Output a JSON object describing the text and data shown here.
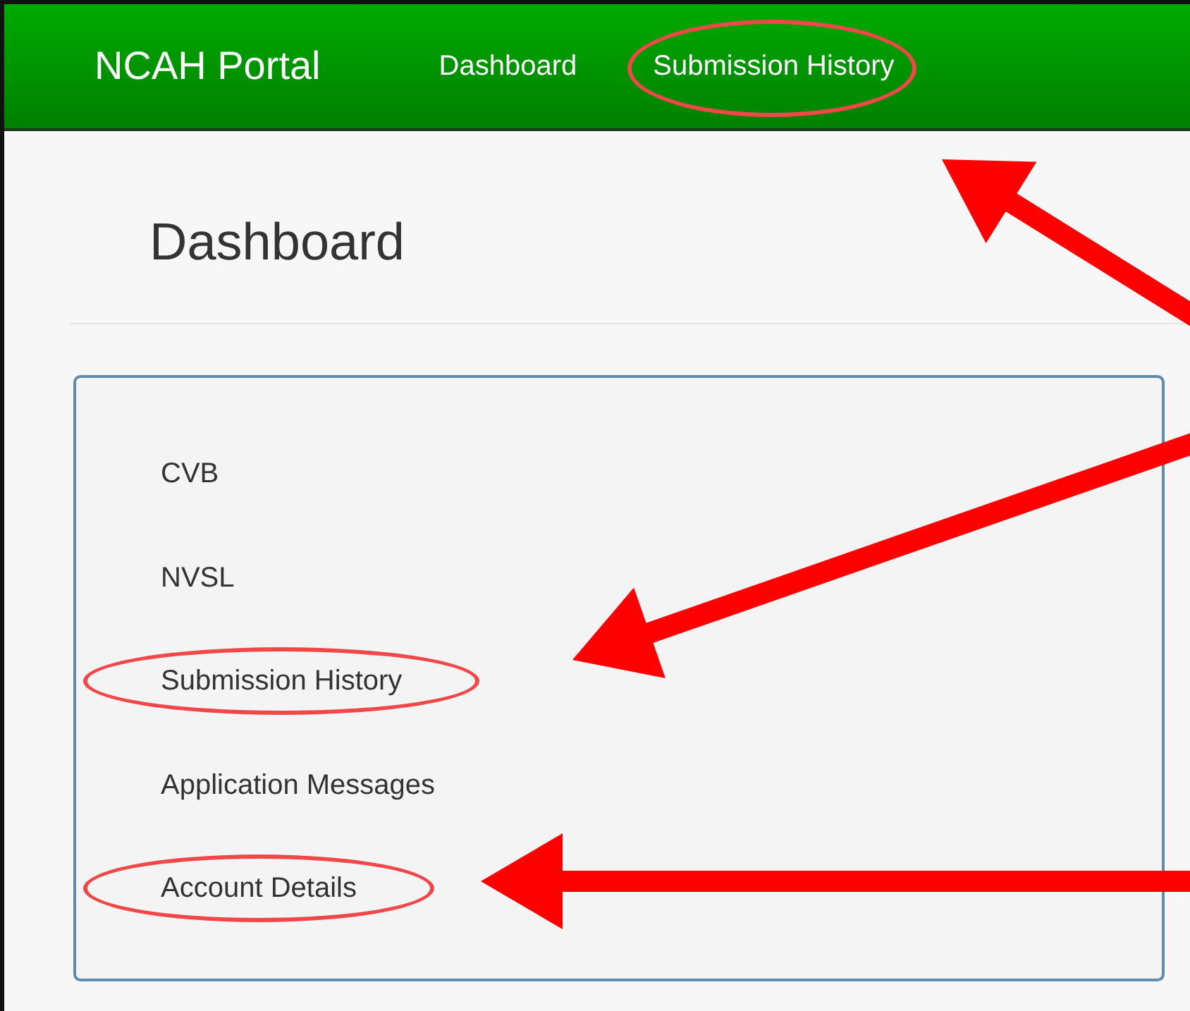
{
  "navbar": {
    "brand": "NCAH Portal",
    "links": [
      {
        "label": "Dashboard",
        "highlighted": false
      },
      {
        "label": "Submission History",
        "highlighted": true
      }
    ]
  },
  "page": {
    "title": "Dashboard"
  },
  "panel": {
    "items": [
      {
        "label": "CVB",
        "highlighted": false
      },
      {
        "label": "NVSL",
        "highlighted": false
      },
      {
        "label": "Submission History",
        "highlighted": true
      },
      {
        "label": "Application Messages",
        "highlighted": false
      },
      {
        "label": "Account Details",
        "highlighted": true
      }
    ]
  }
}
